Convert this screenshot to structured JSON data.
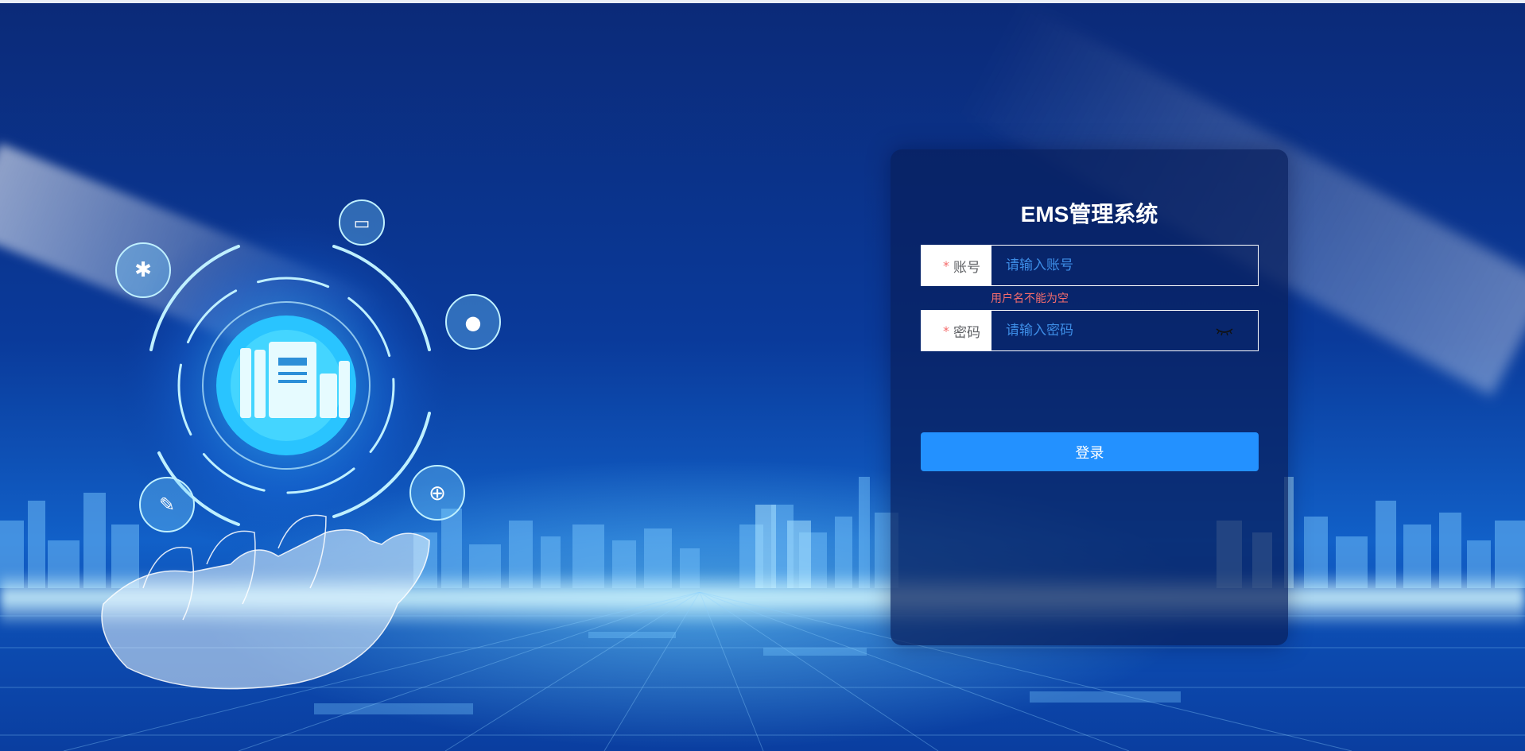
{
  "app": {
    "title": "EMS管理系统"
  },
  "form": {
    "username": {
      "required_mark": "*",
      "label": "账号",
      "placeholder": "请输入账号",
      "value": "",
      "error": "用户名不能为空"
    },
    "password": {
      "required_mark": "*",
      "label": "密码",
      "placeholder": "请输入密码",
      "value": "",
      "toggle_icon": "eye-closed-icon"
    },
    "submit_label": "登录"
  },
  "colors": {
    "primary": "#2391ff",
    "error": "#f56c6c",
    "panel_bg": "#081e5c",
    "label_text": "#606266"
  },
  "illustration": {
    "icons": [
      "gear-icon",
      "chat-bubble-icon",
      "lightbulb-icon",
      "globe-icon",
      "pen-icon",
      "books-icon"
    ]
  }
}
